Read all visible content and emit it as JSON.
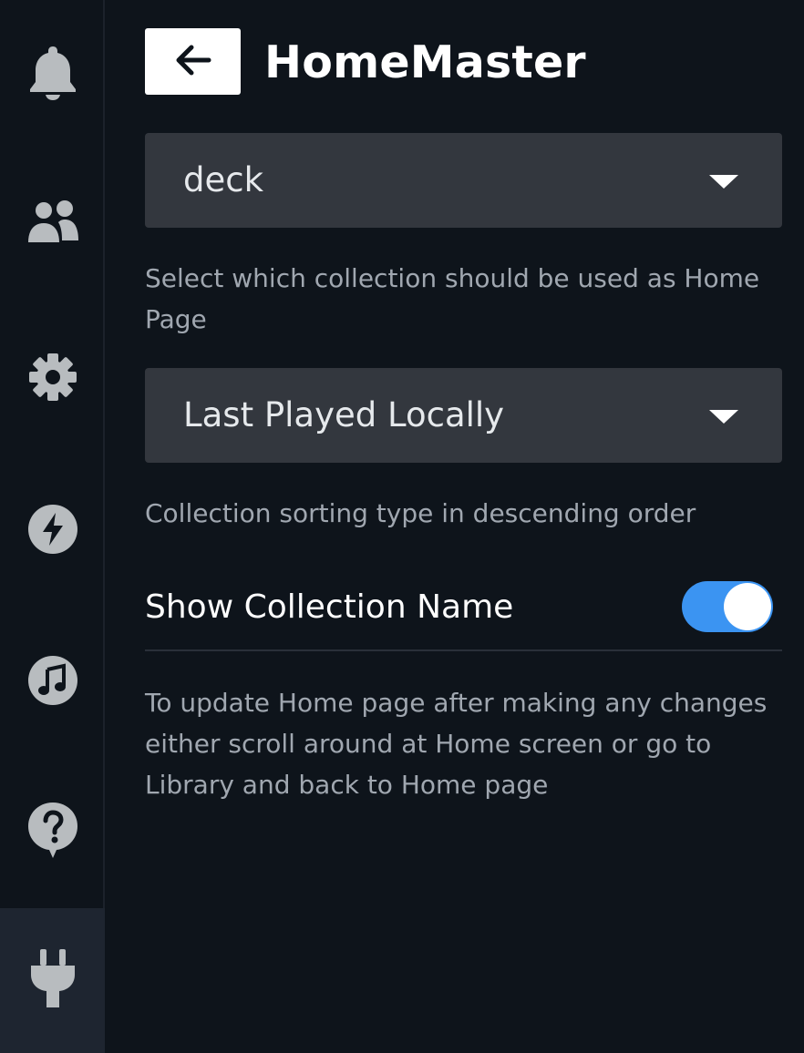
{
  "sidebar": {
    "items": [
      {
        "icon": "bell-icon"
      },
      {
        "icon": "friends-icon"
      },
      {
        "icon": "gear-icon"
      },
      {
        "icon": "lightning-icon"
      },
      {
        "icon": "music-icon"
      },
      {
        "icon": "help-icon"
      },
      {
        "icon": "plug-icon",
        "active": true
      }
    ]
  },
  "header": {
    "back_icon": "arrow-left-icon",
    "title": "HomeMaster"
  },
  "collection": {
    "selected": "deck",
    "description": "Select which collection should be used as Home Page"
  },
  "sorting": {
    "selected": "Last Played Locally",
    "description": "Collection sorting type in descending order"
  },
  "show_name": {
    "label": "Show Collection Name",
    "enabled": true
  },
  "footer_note": "To update Home page after making any changes either scroll around at Home screen or go to Library and back to Home page",
  "colors": {
    "background": "#0e141b",
    "dropdown": "#33373e",
    "toggle_on": "#3b94f2",
    "muted_text": "#a0a7b0",
    "icon": "#b8bcbf"
  }
}
